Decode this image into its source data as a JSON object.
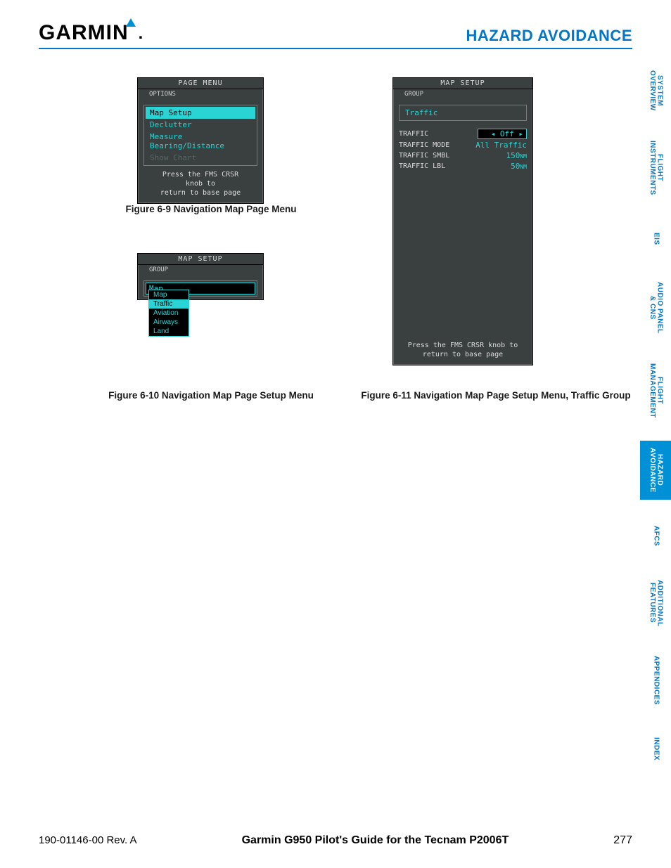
{
  "header": {
    "brand": "GARMIN",
    "section_title": "HAZARD AVOIDANCE"
  },
  "side_tabs": [
    {
      "label": "SYSTEM\nOVERVIEW",
      "active": false
    },
    {
      "label": "FLIGHT\nINSTRUMENTS",
      "active": false
    },
    {
      "label": "EIS",
      "active": false
    },
    {
      "label": "AUDIO PANEL\n& CNS",
      "active": false
    },
    {
      "label": "FLIGHT\nMANAGEMENT",
      "active": false
    },
    {
      "label": "HAZARD\nAVOIDANCE",
      "active": true
    },
    {
      "label": "AFCS",
      "active": false
    },
    {
      "label": "ADDITIONAL\nFEATURES",
      "active": false
    },
    {
      "label": "APPENDICES",
      "active": false
    },
    {
      "label": "INDEX",
      "active": false
    }
  ],
  "fig69": {
    "panel_title": "PAGE MENU",
    "group_label": "OPTIONS",
    "options": [
      {
        "label": "Map Setup",
        "state": "selected"
      },
      {
        "label": "Declutter",
        "state": "normal"
      },
      {
        "label": "Measure Bearing/Distance",
        "state": "normal"
      },
      {
        "label": "Show Chart",
        "state": "disabled"
      }
    ],
    "hint": "Press the FMS CRSR knob to\nreturn to base page",
    "caption": "Figure 6-9  Navigation Map Page Menu"
  },
  "fig610": {
    "panel_title": "MAP SETUP",
    "group_label": "GROUP",
    "field_value": "Map",
    "dropdown": [
      "Map",
      "Traffic",
      "Aviation",
      "Airways",
      "Land"
    ],
    "dropdown_selected": "Traffic",
    "caption": "Figure 6-10  Navigation Map Page Setup Menu"
  },
  "fig611": {
    "panel_title": "MAP SETUP",
    "group_label": "GROUP",
    "field_value": "Traffic",
    "rows": [
      {
        "k": "TRAFFIC",
        "v": "Off",
        "arrows": true
      },
      {
        "k": "TRAFFIC MODE",
        "v": "All Traffic"
      },
      {
        "k": "TRAFFIC SMBL",
        "v": "150",
        "unit": "NM"
      },
      {
        "k": "TRAFFIC LBL",
        "v": "50",
        "unit": "NM"
      }
    ],
    "hint": "Press the FMS CRSR knob to\nreturn to base page",
    "caption": "Figure 6-11  Navigation Map Page Setup Menu, Traffic Group"
  },
  "footer": {
    "doc_id": "190-01146-00  Rev. A",
    "book_title": "Garmin G950 Pilot's Guide for the Tecnam P2006T",
    "page_number": "277"
  }
}
